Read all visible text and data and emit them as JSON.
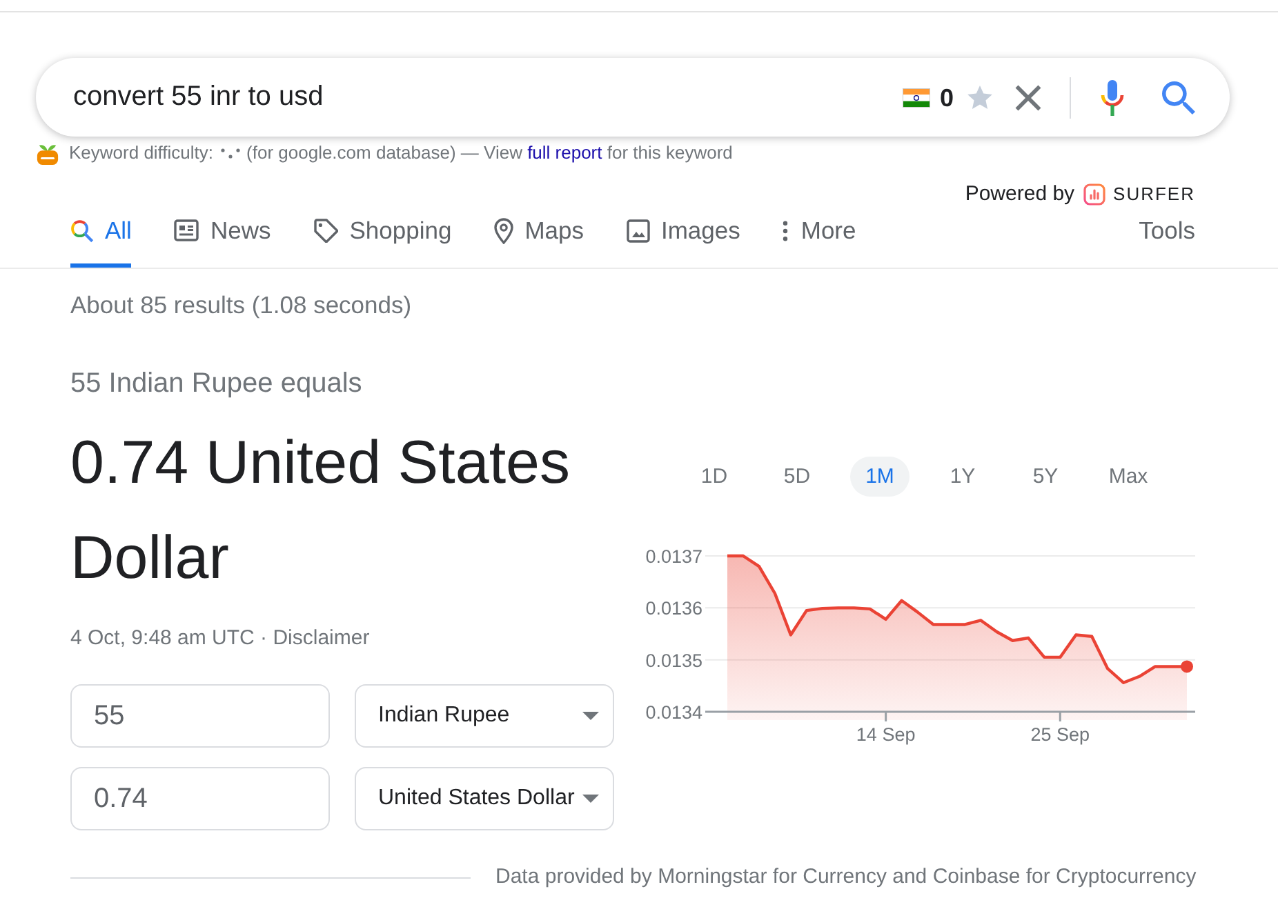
{
  "search_bar": {
    "value": "convert 55 inr to usd",
    "count": "0"
  },
  "keyword_bar": {
    "label": "Keyword difficulty:",
    "text_before_link": "(for google.com database) — View",
    "link": "full report",
    "text_after_link": "for this keyword"
  },
  "powered_by": {
    "label": "Powered by",
    "brand": "SURFER"
  },
  "tabs": [
    {
      "kind": "all",
      "label": "All",
      "selected": true
    },
    {
      "kind": "news",
      "label": "News",
      "selected": false
    },
    {
      "kind": "shopping",
      "label": "Shopping",
      "selected": false
    },
    {
      "kind": "maps",
      "label": "Maps",
      "selected": false
    },
    {
      "kind": "images",
      "label": "Images",
      "selected": false
    },
    {
      "kind": "more",
      "label": "More",
      "selected": false
    }
  ],
  "tools": "Tools",
  "results_stats": "About 85 results (1.08 seconds)",
  "converter": {
    "heading": "55 Indian Rupee equals",
    "result": "0.74 United States Dollar",
    "timestamp": "4 Oct, 9:48 am UTC ·",
    "disclaimer": "Disclaimer",
    "fields": [
      {
        "amount": "55",
        "currency": "Indian Rupee"
      },
      {
        "amount": "0.74",
        "currency": "United States Dollar"
      }
    ]
  },
  "range_tabs": [
    {
      "label": "1D",
      "selected": false
    },
    {
      "label": "5D",
      "selected": false
    },
    {
      "label": "1M",
      "selected": true
    },
    {
      "label": "1Y",
      "selected": false
    },
    {
      "label": "5Y",
      "selected": false
    },
    {
      "label": "Max",
      "selected": false
    }
  ],
  "chart": {
    "chart_data": {
      "type": "area",
      "categories": [
        null,
        null,
        null,
        null,
        null,
        null,
        null,
        null,
        null,
        null,
        "14 Sep",
        null,
        null,
        null,
        null,
        null,
        null,
        null,
        null,
        null,
        null,
        "25 Sep",
        null,
        null,
        null,
        null,
        null,
        null,
        null,
        null
      ],
      "series": [
        {
          "color": "#ea4335",
          "values": [
            0.0137,
            0.0137,
            0.01368,
            0.013628,
            0.013548,
            0.013595,
            0.013599,
            0.0136,
            0.0136,
            0.013598,
            0.013578,
            0.013614,
            0.013592,
            0.013568,
            0.013568,
            0.013568,
            0.013576,
            0.013554,
            0.013537,
            0.013542,
            0.013505,
            0.013505,
            0.013548,
            0.013545,
            0.013483,
            0.013456,
            0.013468,
            0.013487,
            0.013487,
            0.013487
          ]
        }
      ],
      "ylim": [
        0.0134,
        0.0137
      ],
      "yticks": [
        0.0134,
        0.0135,
        0.0136,
        0.0137
      ]
    }
  },
  "footer": {
    "source_note": "Data provided by Morningstar for Currency and Coinbase for Cryptocurrency"
  }
}
